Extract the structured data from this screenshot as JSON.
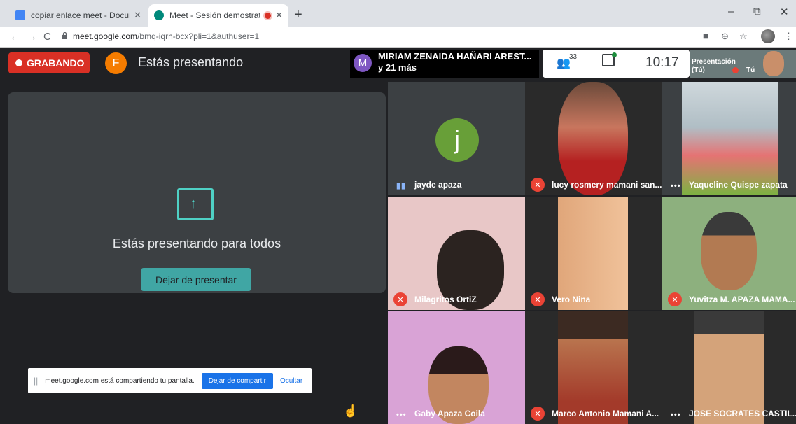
{
  "browser": {
    "tabs": [
      {
        "title": "copiar enlace meet - Documento",
        "active": false
      },
      {
        "title": "Meet - Sesión demostrativa",
        "active": true
      }
    ],
    "new_tab": "+",
    "address": {
      "host": "meet.google.com",
      "path": "/bmq-iqrh-bcx?pli=1&authuser=1"
    },
    "window_controls": {
      "minimize": "–",
      "restore": "⧉",
      "close": "✕"
    }
  },
  "meet": {
    "recording_label": "GRABANDO",
    "presenter_initial": "F",
    "presenting_label": "Estás presentando",
    "active_speaker": {
      "initial": "M",
      "name": "MIRIAM ZENAIDA HAÑARI AREST...",
      "more": "y 21 más"
    },
    "participants_count": "33",
    "clock": "10:17",
    "self_preview": {
      "line1": "Presentación",
      "line2": "(Tú)",
      "you": "Tú"
    },
    "presenting_card": {
      "title": "Estás presentando para todos",
      "stop_button": "Dejar de presentar"
    },
    "share_bar": {
      "grip": "||",
      "text": "meet.google.com está compartiendo tu pantalla.",
      "stop_button": "Dejar de compartir",
      "hide": "Ocultar"
    },
    "tiles": [
      {
        "name": "jayde apaza",
        "status": "talking",
        "avatar_letter": "j"
      },
      {
        "name": "lucy rosmery mamani san...",
        "status": "muted"
      },
      {
        "name": "Yaqueline Quispe zapata",
        "status": "more"
      },
      {
        "name": "Milagritos OrtiZ",
        "status": "muted"
      },
      {
        "name": "Vero Nina",
        "status": "muted"
      },
      {
        "name": "Yuvitza M. APAZA MAMA...",
        "status": "muted"
      },
      {
        "name": "Gaby Apaza Coila",
        "status": "more"
      },
      {
        "name": "Marco Antonio Mamani A...",
        "status": "muted"
      },
      {
        "name": "JOSE SOCRATES CASTIL...",
        "status": "more"
      }
    ]
  },
  "colors": {
    "recording": "#d93025",
    "accent_teal": "#40a6a4",
    "muted": "#ea4335",
    "meet_bg": "#202124"
  }
}
